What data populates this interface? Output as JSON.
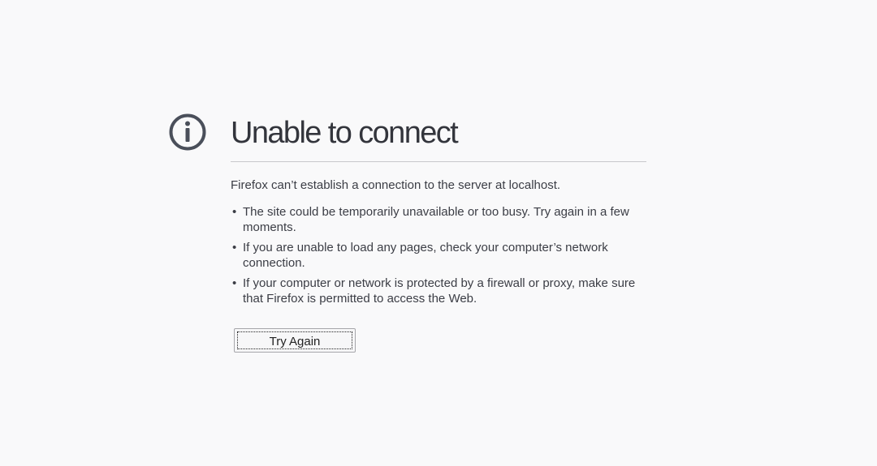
{
  "page": {
    "title": "Unable to connect",
    "short_description": "Firefox can’t establish a connection to the server at localhost.",
    "reasons": [
      "The site could be temporarily unavailable or too busy. Try again in a few moments.",
      "If you are unable to load any pages, check your computer’s network connection.",
      "If your computer or network is protected by a firewall or proxy, make sure that Firefox is permitted to access the Web."
    ],
    "icon": "info-icon",
    "try_again_label": "Try Again"
  },
  "colors": {
    "background": "#f9f9fa",
    "icon": "#4a4f5a",
    "text": "#3b3d45",
    "divider": "#c8c8cc"
  }
}
